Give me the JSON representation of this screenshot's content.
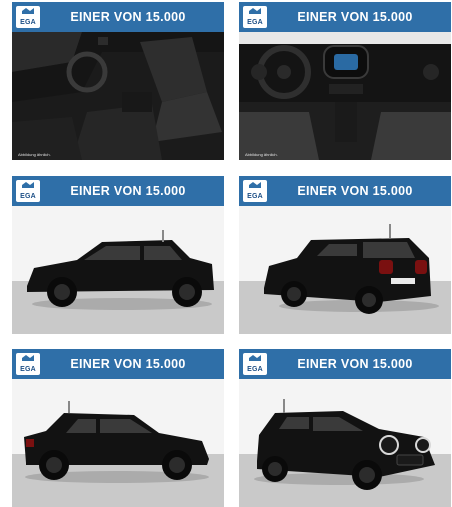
{
  "tiles": [
    {
      "banner": "EINER VON 15.000",
      "logo": "EGA",
      "caption": "Abbildung ähnlich.",
      "view": "interior-front-seats"
    },
    {
      "banner": "EINER VON 15.000",
      "logo": "EGA",
      "caption": "Abbildung ähnlich.",
      "view": "interior-dashboard"
    },
    {
      "banner": "EINER VON 15.000",
      "logo": "EGA",
      "caption": "",
      "view": "exterior-side-left"
    },
    {
      "banner": "EINER VON 15.000",
      "logo": "EGA",
      "caption": "",
      "view": "exterior-rear-three-quarter"
    },
    {
      "banner": "EINER VON 15.000",
      "logo": "EGA",
      "caption": "",
      "view": "exterior-side-right"
    },
    {
      "banner": "EINER VON 15.000",
      "logo": "EGA",
      "caption": "",
      "view": "exterior-front-three-quarter"
    }
  ],
  "colors": {
    "banner": "#2f6fa8",
    "logo_text": "#1d4f86",
    "car_body": "#121212"
  }
}
